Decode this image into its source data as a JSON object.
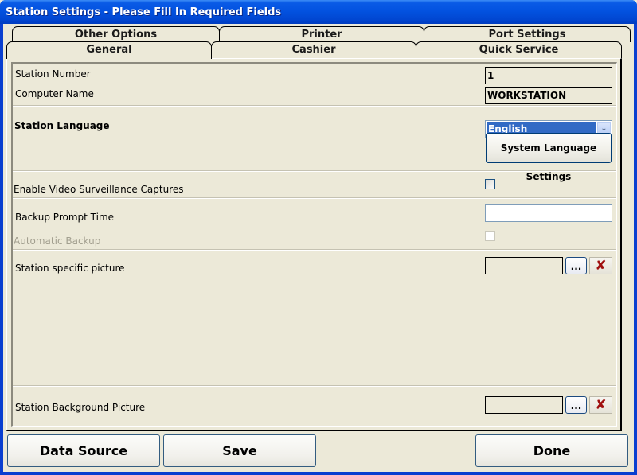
{
  "window": {
    "title": "Station Settings - Please Fill In Required Fields"
  },
  "tabs": {
    "row1": [
      {
        "label": "Other Options"
      },
      {
        "label": "Printer"
      },
      {
        "label": "Port Settings"
      }
    ],
    "row2": [
      {
        "label": "General",
        "active": true
      },
      {
        "label": "Cashier"
      },
      {
        "label": "Quick Service"
      }
    ]
  },
  "general": {
    "station_number": {
      "label": "Station Number",
      "value": "1"
    },
    "computer_name": {
      "label": "Computer Name",
      "value": "WORKSTATION"
    },
    "station_language": {
      "label": "Station Language",
      "selected": "English",
      "dropdown_icon": "chevron-down-icon"
    },
    "system_language_settings_label": "System Language Settings",
    "video_surveillance": {
      "label": "Enable Video Surveillance Captures",
      "checked": false
    },
    "backup_prompt_time": {
      "label": "Backup Prompt Time",
      "value": ""
    },
    "automatic_backup": {
      "label": "Automatic Backup",
      "checked": false,
      "enabled": false
    },
    "station_picture": {
      "label": "Station specific picture",
      "value": "",
      "browse_label": "...",
      "clear_icon": "close-icon"
    },
    "background_picture": {
      "label": "Station Background Picture",
      "value": "",
      "browse_label": "...",
      "clear_icon": "close-icon"
    }
  },
  "footer": {
    "data_source_label": "Data Source",
    "save_label": "Save",
    "done_label": "Done"
  },
  "colors": {
    "titlebar": "#0352e0",
    "selection": "#316ac5",
    "clear_x": "#a01010",
    "background": "#ece9d8"
  }
}
